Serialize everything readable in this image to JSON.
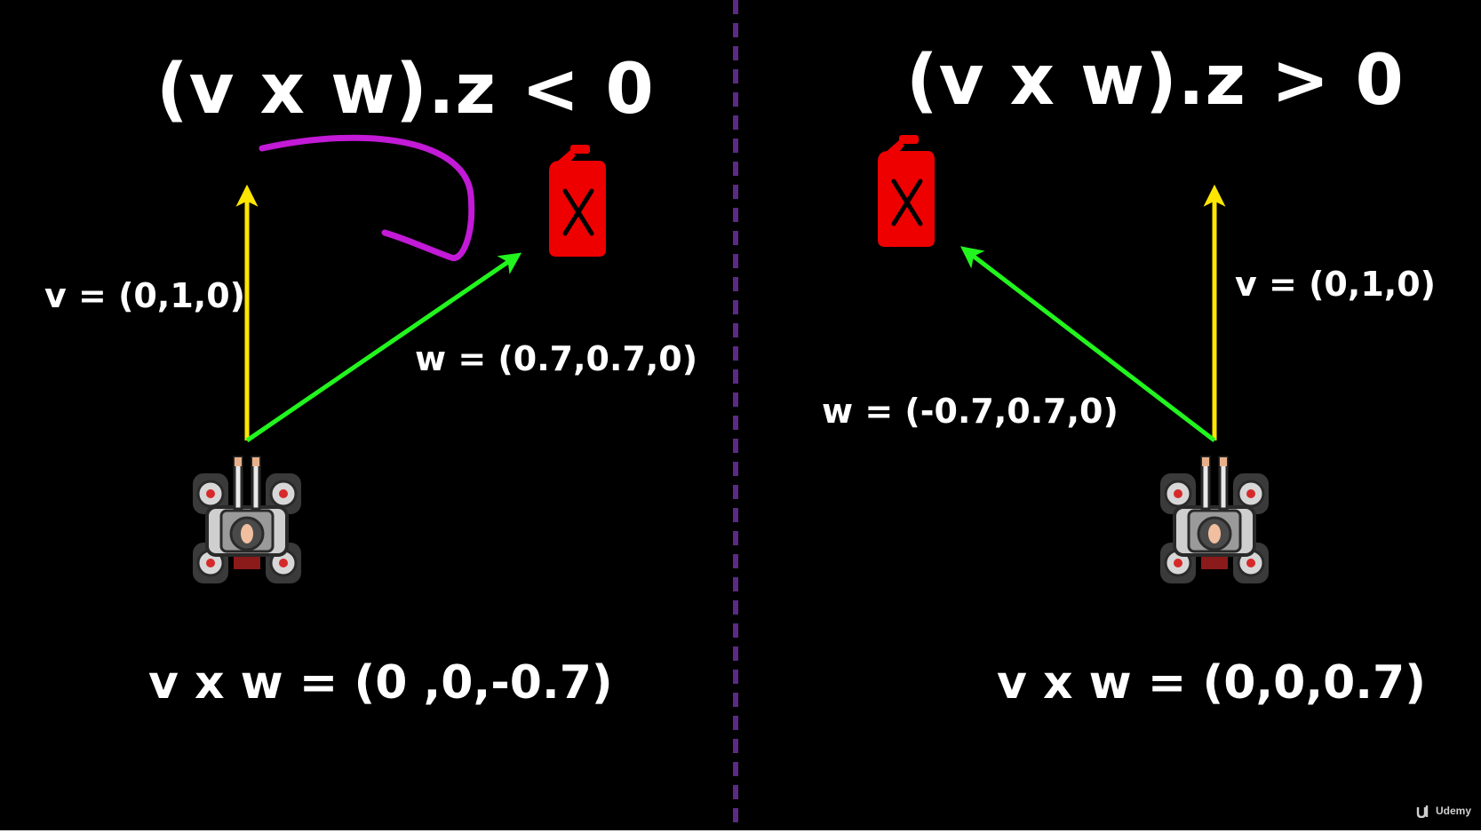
{
  "colors": {
    "background": "#000000",
    "v_arrow": "#ffe600",
    "w_arrow": "#22f51e",
    "rotation_arrow": "#c21ad6",
    "divider": "#5b2a86",
    "fuel_can": "#ee0000",
    "text": "#ffffff"
  },
  "left_panel": {
    "title": "(v x w).z < 0",
    "v_label": "v = (0,1,0)",
    "w_label": "w = (0.7,0.7,0)",
    "result": "v x w = (0 ,0,-0.7)",
    "tank_icon": "tank-icon",
    "target_icon": "fuel-can-icon"
  },
  "right_panel": {
    "title": "(v x w).z > 0",
    "v_label": "v = (0,1,0)",
    "w_label": "w = (-0.7,0.7,0)",
    "result": "v x w = (0,0,0.7)",
    "tank_icon": "tank-icon",
    "target_icon": "fuel-can-icon"
  },
  "watermark": {
    "text": "Udemy",
    "icon": "udemy-logo-icon"
  }
}
